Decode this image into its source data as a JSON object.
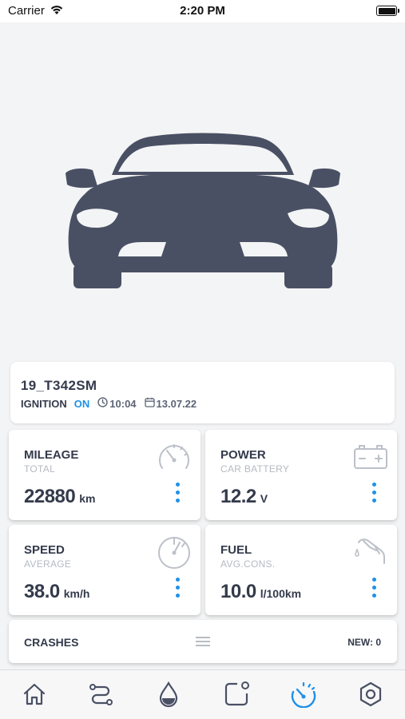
{
  "status_bar": {
    "carrier": "Carrier",
    "time": "2:20 PM"
  },
  "vehicle": {
    "plate": "19_T342SM",
    "ignition_label": "IGNITION",
    "ignition_status": "ON",
    "time": "10:04",
    "date": "13.07.22"
  },
  "stats": {
    "mileage": {
      "title": "MILEAGE",
      "subtitle": "TOTAL",
      "value": "22880",
      "unit": "km",
      "icon": "odometer-icon"
    },
    "power": {
      "title": "POWER",
      "subtitle": "CAR BATTERY",
      "value": "12.2",
      "unit": "V",
      "icon": "car-battery-icon"
    },
    "speed": {
      "title": "SPEED",
      "subtitle": "AVERAGE",
      "value": "38.0",
      "unit": "km/h",
      "icon": "speedometer-icon"
    },
    "fuel": {
      "title": "FUEL",
      "subtitle": "AVG.CONS.",
      "value": "10.0",
      "unit": "l/100km",
      "icon": "fuel-nozzle-icon"
    }
  },
  "crashes": {
    "title": "CRASHES",
    "new_count": "NEW: 0"
  },
  "tab_bar": {
    "active": "dashboard",
    "tabs": [
      "home-icon",
      "route-icon",
      "fuel-drop-icon",
      "notification-icon",
      "dashboard-gauge-icon",
      "settings-hexagon-icon"
    ]
  },
  "colors": {
    "accent": "#1e90e8",
    "car": "#4a5064",
    "icon_gray": "#bcc0c8",
    "text_dark": "#333a4b"
  }
}
